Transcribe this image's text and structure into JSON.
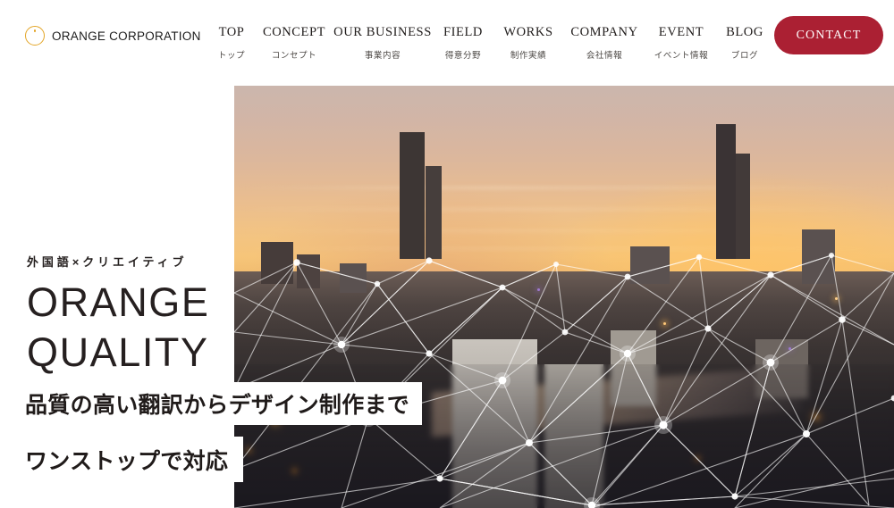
{
  "header": {
    "logo": {
      "mark_icon": "orange-circle-icon",
      "text": "ORANGE CORPORATION",
      "ring_color": "#e3a526"
    },
    "nav_items": [
      {
        "en": "TOP",
        "jp": "トップ"
      },
      {
        "en": "CONCEPT",
        "jp": "コンセプト"
      },
      {
        "en": "OUR BUSINESS",
        "jp": "事業内容"
      },
      {
        "en": "FIELD",
        "jp": "得意分野"
      },
      {
        "en": "WORKS",
        "jp": "制作実績"
      },
      {
        "en": "COMPANY",
        "jp": "会社情報"
      },
      {
        "en": "EVENT",
        "jp": "イベント情報"
      },
      {
        "en": "BLOG",
        "jp": "ブログ"
      }
    ],
    "contact_button": {
      "label": "CONTACT",
      "color": "#ab2033"
    }
  },
  "hero": {
    "kicker": "外国語×クリエイティブ",
    "title_line1": "ORANGE",
    "title_line2": "QUALITY",
    "tagline_line1": "品質の高い翻訳からデザイン制作まで",
    "tagline_line2": "ワンストップで対応",
    "image_alt": "aerial-city-sunset-network"
  }
}
